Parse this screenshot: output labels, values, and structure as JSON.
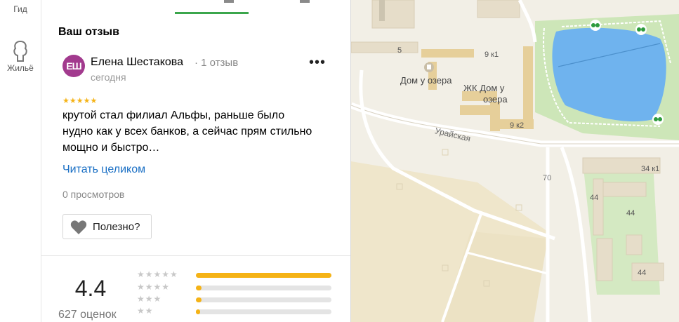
{
  "rail": {
    "guide_label": "Гид",
    "housing_label": "Жильё"
  },
  "review_section": {
    "title": "Ваш отзыв"
  },
  "review": {
    "avatar_initials": "ЕШ",
    "author": "Елена Шестакова",
    "review_count": "· 1 отзыв",
    "date": "сегодня",
    "more_icon": "more-dots-icon",
    "stars": "★★★★★",
    "rating": 5,
    "text": "крутой стал филиал Альфы, раньше было нудно как у всех банков, а сейчас прям стильно мощно и быстро…",
    "read_more": "Читать целиком",
    "views": "0 просмотров",
    "helpful_label": "Полезно?"
  },
  "rating_summary": {
    "value": "4.4",
    "count": "627 оценок",
    "distribution": [
      {
        "stars": "★★★★★",
        "fraction": 1.0
      },
      {
        "stars": "★★★★",
        "fraction": 0.04
      },
      {
        "stars": "★★★",
        "fraction": 0.04
      },
      {
        "stars": "★★",
        "fraction": 0.03
      }
    ]
  },
  "map": {
    "labels": {
      "house5": "5",
      "house9k1": "9 к1",
      "place_dom": "Дом у озера",
      "place_zhk_line1": "ЖК Дом у",
      "place_zhk_line2": "озера",
      "house9k2": "9 к2",
      "street": "Урайская",
      "house70": "70",
      "house34k1": "34 к1",
      "house44a": "44",
      "house44b": "44",
      "house44c": "44"
    },
    "colors": {
      "land": "#f2efe6",
      "buildings": "#e8e1cf",
      "green": "#c9e3b5",
      "water": "#6fb3ee",
      "road": "#ffffff",
      "sand": "#f0e6c8"
    }
  },
  "colors": {
    "accent": "#3ba64c",
    "star": "#f5b316",
    "link": "#1a6fc4",
    "avatar": "#a23a8e"
  }
}
